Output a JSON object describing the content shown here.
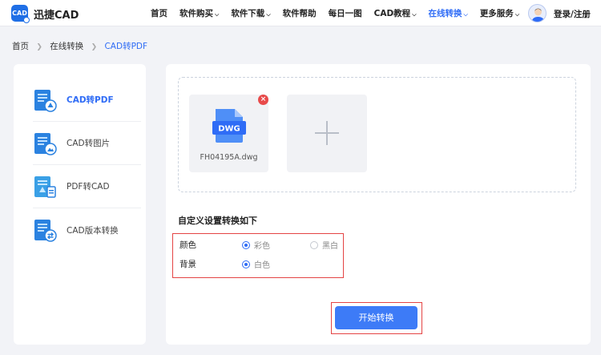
{
  "header": {
    "brand": "迅捷CAD",
    "logo_text": "CAD",
    "nav": [
      {
        "label": "首页",
        "caret": false,
        "active": false
      },
      {
        "label": "软件购买",
        "caret": true,
        "active": false
      },
      {
        "label": "软件下载",
        "caret": true,
        "active": false
      },
      {
        "label": "软件帮助",
        "caret": false,
        "active": false
      },
      {
        "label": "每日一图",
        "caret": false,
        "active": false
      },
      {
        "label": "CAD教程",
        "caret": true,
        "active": false
      },
      {
        "label": "在线转换",
        "caret": true,
        "active": true
      },
      {
        "label": "更多服务",
        "caret": true,
        "active": false
      }
    ],
    "login": "登录/注册"
  },
  "breadcrumb": {
    "home": "首页",
    "section": "在线转换",
    "current": "CAD转PDF"
  },
  "sidebar": {
    "items": [
      {
        "label": "CAD转PDF",
        "icon": "cad-to-pdf-icon",
        "active": true
      },
      {
        "label": "CAD转图片",
        "icon": "cad-to-image-icon",
        "active": false
      },
      {
        "label": "PDF转CAD",
        "icon": "pdf-to-cad-icon",
        "active": false
      },
      {
        "label": "CAD版本转换",
        "icon": "cad-version-icon",
        "active": false
      }
    ]
  },
  "upload": {
    "file": {
      "name": "FH04195A.dwg",
      "badge": "DWG"
    }
  },
  "settings": {
    "title": "自定义设置转换如下",
    "color_label": "颜色",
    "color_opt1": "彩色",
    "color_opt2": "黑白",
    "bg_label": "背景",
    "bg_opt1": "白色"
  },
  "start_button": "开始转换",
  "colors": {
    "accent": "#2f6cf6",
    "button": "#3d7bf7",
    "highlight": "#e44444",
    "delete": "#e84a4a"
  }
}
